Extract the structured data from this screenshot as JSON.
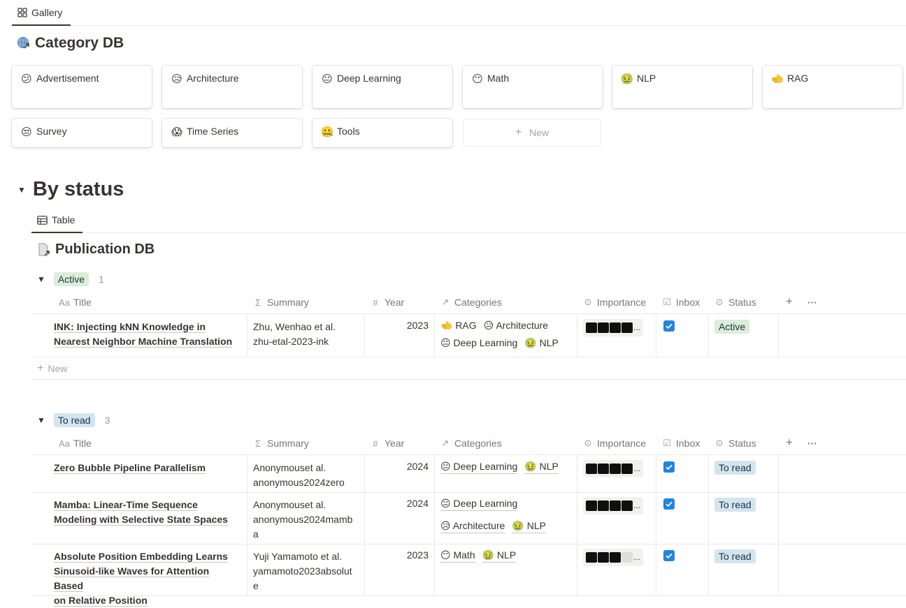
{
  "top_tab": {
    "label": "Gallery",
    "icon": "gallery-grid-icon"
  },
  "category_db": {
    "title": "Category DB",
    "icon": "linked-db-globe-icon",
    "cards": [
      {
        "emoji": "😕",
        "label": "Advertisement"
      },
      {
        "emoji": "😥",
        "label": "Architecture"
      },
      {
        "emoji": "😐",
        "label": "Deep Learning"
      },
      {
        "emoji": "😶",
        "label": "Math"
      },
      {
        "emoji": "🤢",
        "label": "NLP"
      },
      {
        "emoji": "🫲",
        "label": "RAG"
      },
      {
        "emoji": "😒",
        "label": "Survey"
      },
      {
        "emoji": "😱",
        "label": "Time Series"
      },
      {
        "emoji": "🤐",
        "label": "Tools"
      }
    ],
    "new_label": "New"
  },
  "section": {
    "heading": "By status"
  },
  "table_tab": {
    "label": "Table",
    "icon": "table-icon"
  },
  "publication_db": {
    "title": "Publication DB",
    "icon": "linked-page-icon"
  },
  "columns": {
    "title": "Title",
    "title_icon": "Aa",
    "summary": "Summary",
    "summary_icon": "Σ",
    "year": "Year",
    "year_icon": "#",
    "categories": "Categories",
    "categories_icon": "↗",
    "importance": "Importance",
    "inbox": "Inbox",
    "status": "Status",
    "add": "+",
    "more": "···"
  },
  "groups": {
    "active": {
      "label": "Active",
      "count": "1",
      "new_label": "New",
      "rows": [
        {
          "title_1": "INK: Injecting kNN Knowledge in",
          "title_2": "Nearest Neighbor Machine Translation",
          "summary_1": "Zhu, Wenhao  et al.",
          "summary_2": "zhu-etal-2023-ink",
          "year": "2023",
          "cats": [
            "🫲 RAG",
            "😥 Architecture",
            "😐 Deep Learning",
            "🤢 NLP"
          ],
          "importance": 4,
          "status": "Active"
        }
      ]
    },
    "to_read": {
      "label": "To read",
      "count": "3",
      "rows": [
        {
          "title_1": "Zero Bubble Pipeline Parallelism",
          "summary_1": "Anonymouset al.",
          "summary_2": "anonymous2024zero",
          "year": "2024",
          "cats": [
            "😐 Deep Learning",
            "🤢 NLP"
          ],
          "importance": 4,
          "status": "To read"
        },
        {
          "title_1": "Mamba: Linear-Time Sequence",
          "title_2": "Modeling with Selective State Spaces",
          "summary_1": "Anonymouset al.",
          "summary_2": "anonymous2024mamb",
          "summary_3": "a",
          "year": "2024",
          "cats": [
            "😐 Deep Learning",
            "😥 Architecture",
            "🤢 NLP"
          ],
          "importance": 4,
          "status": "To read"
        },
        {
          "title_1": "Absolute Position Embedding Learns",
          "title_2": "Sinusoid-like Waves for Attention Based",
          "title_3": "on Relative Position",
          "summary_1": "Yuji Yamamoto et al.",
          "summary_2": "yamamoto2023absolut",
          "summary_3": "e",
          "year": "2023",
          "cats": [
            "😶 Math",
            "🤢 NLP"
          ],
          "importance": 3,
          "status": "To read"
        }
      ]
    }
  },
  "colors": {
    "checkbox": "#2383e2",
    "active_bg": "#dbeddb",
    "toread_bg": "#d3e5ef"
  }
}
